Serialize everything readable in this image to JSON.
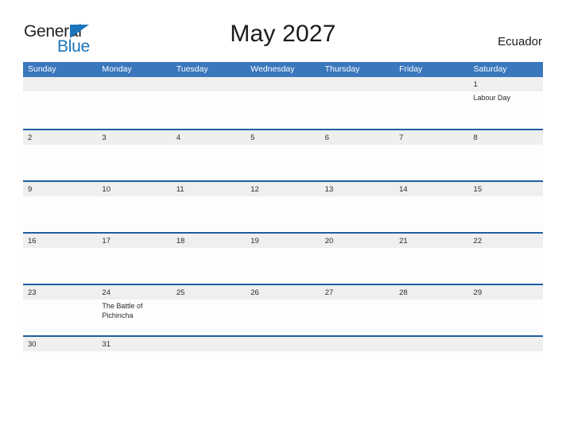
{
  "brand": {
    "name_part1": "General",
    "name_part2": "Blue",
    "flag_icon": "triangle-flag-icon",
    "color_dark": "#231f20",
    "color_blue": "#1b75bb"
  },
  "header": {
    "title": "May 2027",
    "country": "Ecuador"
  },
  "colors": {
    "header_blue": "#3a77bd",
    "divider_blue": "#1f5fa0",
    "band_gray": "#efefef",
    "text": "#2b2b2b"
  },
  "calendar": {
    "weekdays": [
      "Sunday",
      "Monday",
      "Tuesday",
      "Wednesday",
      "Thursday",
      "Friday",
      "Saturday"
    ],
    "weeks": [
      {
        "days": [
          {
            "num": "",
            "events": []
          },
          {
            "num": "",
            "events": []
          },
          {
            "num": "",
            "events": []
          },
          {
            "num": "",
            "events": []
          },
          {
            "num": "",
            "events": []
          },
          {
            "num": "",
            "events": []
          },
          {
            "num": "1",
            "events": [
              "Labour Day"
            ]
          }
        ]
      },
      {
        "days": [
          {
            "num": "2",
            "events": []
          },
          {
            "num": "3",
            "events": []
          },
          {
            "num": "4",
            "events": []
          },
          {
            "num": "5",
            "events": []
          },
          {
            "num": "6",
            "events": []
          },
          {
            "num": "7",
            "events": []
          },
          {
            "num": "8",
            "events": []
          }
        ]
      },
      {
        "days": [
          {
            "num": "9",
            "events": []
          },
          {
            "num": "10",
            "events": []
          },
          {
            "num": "11",
            "events": []
          },
          {
            "num": "12",
            "events": []
          },
          {
            "num": "13",
            "events": []
          },
          {
            "num": "14",
            "events": []
          },
          {
            "num": "15",
            "events": []
          }
        ]
      },
      {
        "days": [
          {
            "num": "16",
            "events": []
          },
          {
            "num": "17",
            "events": []
          },
          {
            "num": "18",
            "events": []
          },
          {
            "num": "19",
            "events": []
          },
          {
            "num": "20",
            "events": []
          },
          {
            "num": "21",
            "events": []
          },
          {
            "num": "22",
            "events": []
          }
        ]
      },
      {
        "days": [
          {
            "num": "23",
            "events": []
          },
          {
            "num": "24",
            "events": [
              "The Battle of Pichincha"
            ]
          },
          {
            "num": "25",
            "events": []
          },
          {
            "num": "26",
            "events": []
          },
          {
            "num": "27",
            "events": []
          },
          {
            "num": "28",
            "events": []
          },
          {
            "num": "29",
            "events": []
          }
        ]
      },
      {
        "last": true,
        "days": [
          {
            "num": "30",
            "events": []
          },
          {
            "num": "31",
            "events": []
          },
          {
            "num": "",
            "events": []
          },
          {
            "num": "",
            "events": []
          },
          {
            "num": "",
            "events": []
          },
          {
            "num": "",
            "events": []
          },
          {
            "num": "",
            "events": []
          }
        ]
      }
    ]
  }
}
